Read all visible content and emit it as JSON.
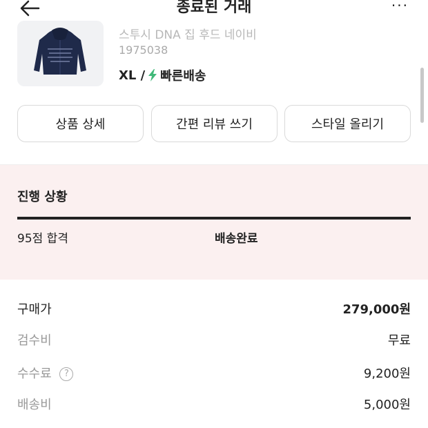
{
  "header": {
    "title": "종료된 거래",
    "more": "···"
  },
  "product": {
    "name": "스투시 DNA 집 후드 네이비",
    "code": "1975038",
    "size": "XL /",
    "shipping": "빠른배송"
  },
  "actions": [
    {
      "label": "상품 상세"
    },
    {
      "label": "간편 리뷰 쓰기"
    },
    {
      "label": "스타일 올리기"
    }
  ],
  "progress": {
    "title": "진행 상황",
    "step_left": "95점 합격",
    "step_status": "배송완료"
  },
  "prices": {
    "purchase_label": "구매가",
    "purchase_value": "279,000원",
    "inspection_label": "검수비",
    "inspection_value": "무료",
    "fee_label": "수수료",
    "fee_help": "?",
    "fee_value": "9,200원",
    "shipping_label": "배송비",
    "shipping_value": "5,000원"
  },
  "colors": {
    "progress_bg": "#fbf0f0",
    "bolt": "#41b979",
    "thumb_bg": "#f1f2f4"
  }
}
